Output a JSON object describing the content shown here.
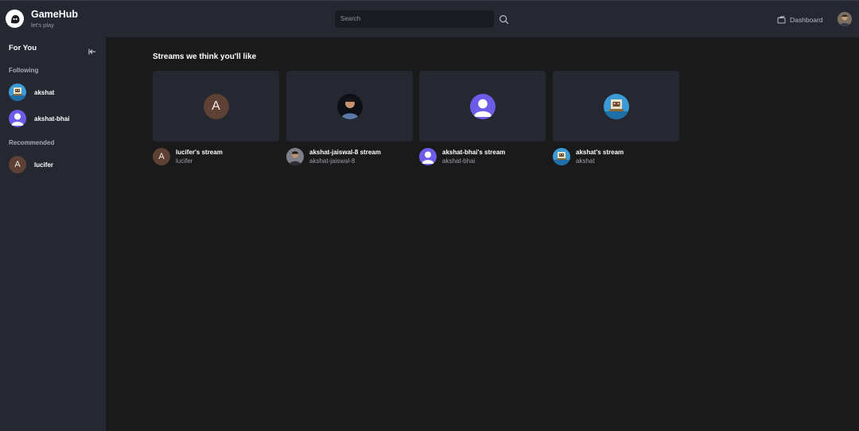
{
  "header": {
    "app_name": "GameHub",
    "tagline": "let's play",
    "search_placeholder": "Search",
    "dashboard_label": "Dashboard"
  },
  "sidebar": {
    "title": "For You",
    "following_label": "Following",
    "following": [
      {
        "name": "akshat",
        "avatar": "pixel-art-avatar"
      },
      {
        "name": "akshat-bhai",
        "avatar": "default-user-avatar"
      }
    ],
    "recommended_label": "Recommended",
    "recommended": [
      {
        "name": "lucifer",
        "avatar": "letter-avatar",
        "initial": "A"
      }
    ]
  },
  "main": {
    "section_title": "Streams we think you'll like",
    "streams": [
      {
        "title": "lucifer's stream",
        "username": "lucifer",
        "avatar": "letter-avatar",
        "initial": "A"
      },
      {
        "title": "akshat-jaiswal-8 stream",
        "username": "akshat-jaiswal-8",
        "avatar": "photo-avatar"
      },
      {
        "title": "akshat-bhai's stream",
        "username": "akshat-bhai",
        "avatar": "default-user-avatar"
      },
      {
        "title": "akshat's stream",
        "username": "akshat",
        "avatar": "pixel-art-avatar"
      }
    ]
  },
  "colors": {
    "background": "#1a1a1b",
    "panel": "#252731",
    "accent_purple": "#6c5ce7",
    "letter_avatar": "#5e4034"
  }
}
